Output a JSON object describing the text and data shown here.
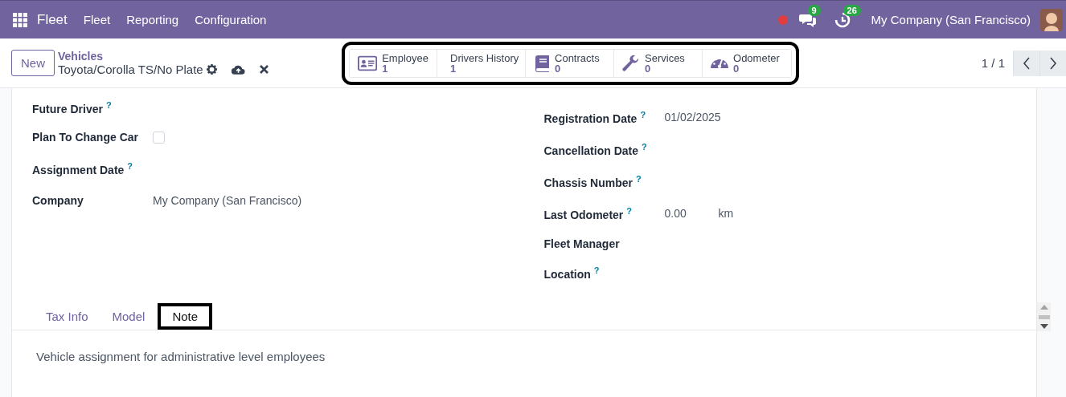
{
  "navbar": {
    "app": "Fleet",
    "menus": [
      "Fleet",
      "Reporting",
      "Configuration"
    ],
    "recording": true,
    "messages_badge": "9",
    "activities_badge": "26",
    "company": "My Company (San Francisco)"
  },
  "control_panel": {
    "new_button": "New",
    "breadcrumb": "Vehicles",
    "record": "Toyota/Corolla TS/No Plate",
    "pager": "1 / 1"
  },
  "stat_buttons": {
    "highlighted": true,
    "items": [
      {
        "kind": "employee",
        "label": "Employee",
        "value": "1"
      },
      {
        "kind": "history",
        "label": "Drivers History",
        "value": "1"
      },
      {
        "kind": "contracts",
        "label": "Contracts",
        "value": "0"
      },
      {
        "kind": "services",
        "label": "Services",
        "value": "0"
      },
      {
        "kind": "odometer",
        "label": "Odometer",
        "value": "0"
      }
    ]
  },
  "left_fields": [
    {
      "kind": "empty",
      "label": "Future Driver",
      "help": "?"
    },
    {
      "kind": "checkbox",
      "label": "Plan To Change Car",
      "checked": false
    },
    {
      "kind": "empty",
      "label": "Assignment Date",
      "help": "?"
    },
    {
      "kind": "text",
      "label": "Company",
      "value": "My Company (San Francisco)"
    }
  ],
  "right_fields": [
    {
      "kind": "text",
      "label": "Registration Date",
      "help": "?",
      "value": "01/02/2025"
    },
    {
      "kind": "empty",
      "label": "Cancellation Date",
      "help": "?"
    },
    {
      "kind": "empty",
      "label": "Chassis Number",
      "help": "?"
    },
    {
      "kind": "unit",
      "label": "Last Odometer",
      "help": "?",
      "value": "0.00",
      "unit": "km"
    },
    {
      "kind": "empty",
      "label": "Fleet Manager"
    },
    {
      "kind": "empty",
      "label": "Location",
      "help": "?"
    }
  ],
  "notebook": {
    "tabs": [
      {
        "label": "Tax Info",
        "selected": false,
        "highlighted": false
      },
      {
        "label": "Model",
        "selected": false,
        "highlighted": false
      },
      {
        "label": "Note",
        "selected": true,
        "highlighted": true
      }
    ],
    "note": "Vehicle assignment for administrative level employees"
  }
}
